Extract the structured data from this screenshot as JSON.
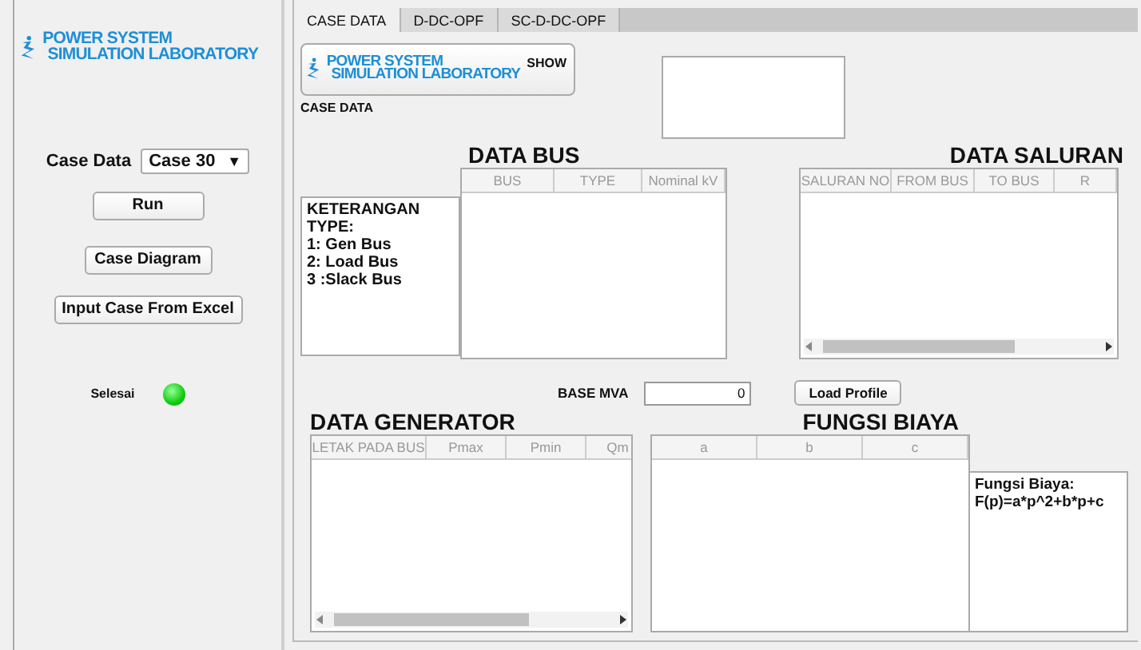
{
  "sidebar": {
    "logo": {
      "line1": "POWER SYSTEM",
      "line2": "SIMULATION LABORATORY"
    },
    "case_label": "Case Data",
    "case_select": {
      "value": "Case 30",
      "arrow": "▼"
    },
    "buttons": [
      "Run",
      "Case Diagram",
      "Input Case From Excel"
    ],
    "status": {
      "label": "Selesai",
      "on": true
    }
  },
  "tabs": [
    {
      "label": "CASE DATA",
      "selected": true
    },
    {
      "label": "D-DC-OPF",
      "selected": false
    },
    {
      "label": "SC-D-DC-OPF",
      "selected": false
    }
  ],
  "case_data": {
    "logo_button": {
      "line1": "POWER SYSTEM",
      "line2": "SIMULATION LABORATORY",
      "label": "SHOW"
    },
    "caption": "CASE DATA"
  },
  "legend": {
    "lines": [
      "KETERANGAN",
      "TYPE:",
      "1: Gen Bus",
      "2: Load Bus",
      "3 :Slack Bus"
    ]
  },
  "data_bus": {
    "title": "DATA BUS",
    "columns": [
      "BUS",
      "TYPE",
      "Nominal kV"
    ]
  },
  "data_saluran": {
    "title": "DATA SALURAN",
    "columns": [
      "SALURAN NO",
      "FROM BUS",
      "TO BUS",
      "R"
    ]
  },
  "base_mva": {
    "label": "BASE MVA",
    "value": "0"
  },
  "load_profile_button": "Load Profile",
  "data_generator": {
    "title": "DATA GENERATOR",
    "columns": [
      "LETAK PADA BUS",
      "Pmax",
      "Pmin",
      "Qm"
    ]
  },
  "fungsi_biaya": {
    "title": "FUNGSI BIAYA",
    "columns": [
      "a",
      "b",
      "c"
    ],
    "note": [
      "Fungsi Biaya:",
      "F(p)=a*p^2+b*p+c"
    ]
  }
}
